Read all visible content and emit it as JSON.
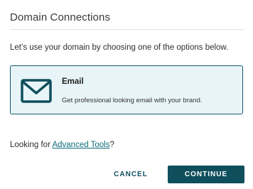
{
  "dialog": {
    "title": "Domain Connections",
    "intro": "Let’s use your domain by choosing one of the options below."
  },
  "options": [
    {
      "icon": "mail-icon",
      "title": "Email",
      "description": "Get professional looking email with your brand."
    }
  ],
  "footer": {
    "looking_prefix": "Looking for ",
    "advanced_tools_link": "Advanced Tools",
    "looking_suffix": "?"
  },
  "actions": {
    "cancel_label": "CANCEL",
    "continue_label": "CONTINUE"
  },
  "colors": {
    "accent": "#0f4f5c",
    "card_background": "#e8f5f8",
    "link": "#0f6b7a"
  }
}
